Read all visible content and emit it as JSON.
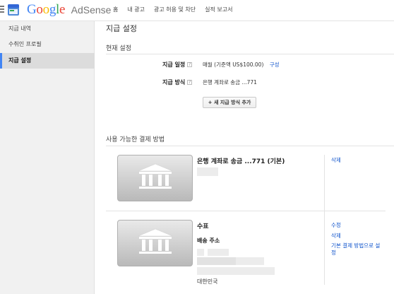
{
  "header": {
    "brand_google": "Google",
    "brand_product": "AdSense",
    "nav": [
      "홈",
      "내 광고",
      "광고 허용 및 차단",
      "실적 보고서"
    ]
  },
  "sidebar": {
    "items": [
      {
        "label": "지급 내역",
        "active": false
      },
      {
        "label": "수취인 프로필",
        "active": false
      },
      {
        "label": "지급 설정",
        "active": true
      }
    ]
  },
  "main": {
    "page_title": "지급 설정",
    "current_settings": {
      "title": "현재 설정",
      "schedule_label": "지급 일정",
      "schedule_value": "매월 (기준액 US$100.00)",
      "schedule_link": "구성",
      "method_label": "지급 방식",
      "method_value": "은행 계좌로 송금 ...771",
      "add_button": "+ 새 지급 방식 추가"
    },
    "available_methods": {
      "title": "사용 가능한 결제 방법",
      "items": [
        {
          "icon": "bank-icon",
          "title": "은행 계좌로 송금 ...771 (기본)",
          "actions": [
            "삭제"
          ]
        },
        {
          "icon": "bank-icon",
          "title": "수표",
          "address_label": "배송 주소",
          "country": "대한민국",
          "actions": [
            "수정",
            "삭제",
            "기본 결제 방법으로 설정"
          ]
        }
      ]
    }
  },
  "colors": {
    "link": "#1155cc",
    "sidebar_bg": "#f1f1f1",
    "active_bg": "#dcdcdc"
  }
}
